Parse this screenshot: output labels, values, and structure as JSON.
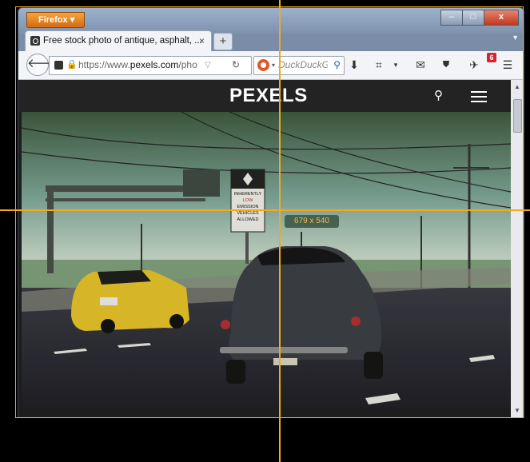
{
  "browser": {
    "app_button": "Firefox",
    "tab": {
      "title": "Free stock photo of antique, asphalt, ...",
      "close_label": "×"
    },
    "new_tab_label": "+",
    "url": {
      "prefix": "https://www.",
      "domain": "pexels.com",
      "suffix": "/pho"
    },
    "search_placeholder": "DuckDuckGo",
    "notification_count": "6",
    "window_controls": {
      "minimize": "–",
      "maximize": "□",
      "close": "x"
    }
  },
  "site": {
    "logo": "PEXELS",
    "photo": {
      "sky_colors": [
        "#3d5a3e",
        "#7fa89a",
        "#c7d9c9"
      ],
      "road_color": "#2c2c33"
    },
    "road_sign": {
      "lines": [
        "INHERENTLY",
        "LOW",
        "EMISSION",
        "VEHICLES",
        "ALLOWED"
      ]
    },
    "plate_front": "",
    "plate_back": ""
  },
  "overlay": {
    "dimension_label": "679 x 540",
    "guide_color": "#f4a81c"
  },
  "icons": [
    "back-icon",
    "site-identity-icon",
    "lock-icon",
    "reload-icon",
    "search-icon",
    "download-icon",
    "crop-icon",
    "mail-icon",
    "ublock-icon",
    "bell-icon",
    "menu-icon"
  ]
}
